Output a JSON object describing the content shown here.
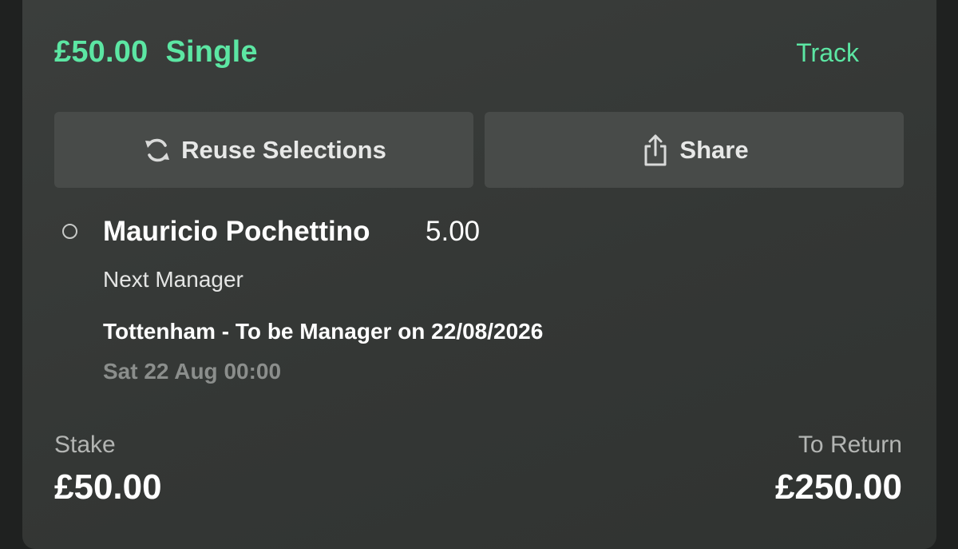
{
  "header": {
    "amount": "£50.00",
    "bet_type": "Single",
    "track_label": "Track"
  },
  "actions": {
    "reuse_label": "Reuse Selections",
    "share_label": "Share"
  },
  "selection": {
    "name": "Mauricio Pochettino",
    "odds": "5.00",
    "market": "Next Manager",
    "event": "Tottenham - To be Manager on 22/08/2026",
    "time": "Sat 22 Aug 00:00"
  },
  "summary": {
    "stake_label": "Stake",
    "stake_value": "£50.00",
    "return_label": "To Return",
    "return_value": "£250.00"
  },
  "colors": {
    "accent": "#5ce6a3",
    "card_bg": "#363937",
    "button_bg": "#484b49"
  },
  "icons": {
    "reuse": "refresh-icon",
    "share": "share-icon",
    "status": "pending-circle-icon"
  }
}
